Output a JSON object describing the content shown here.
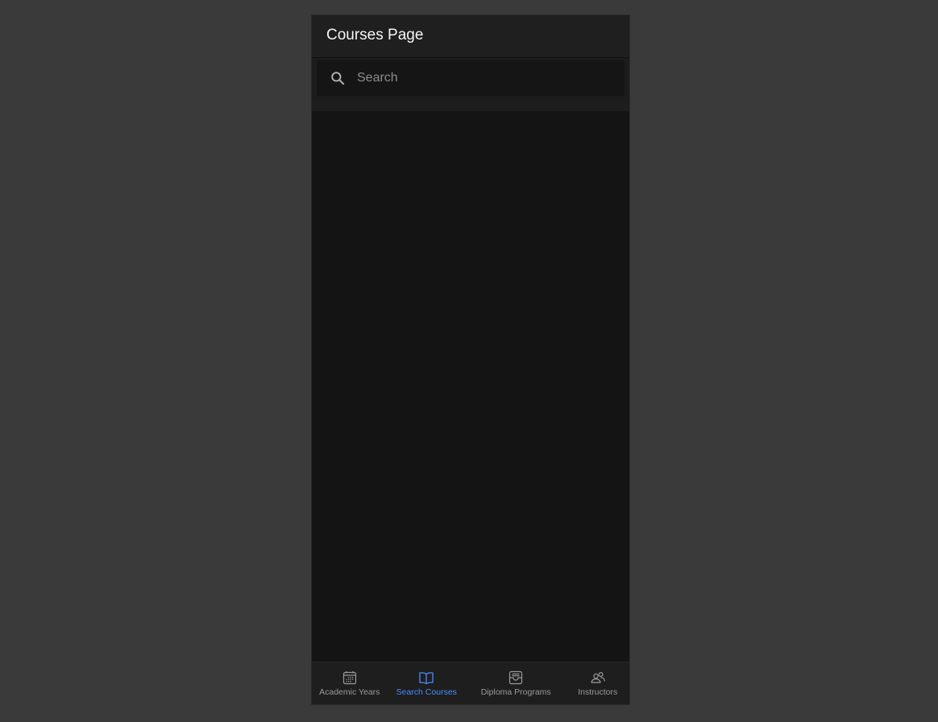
{
  "header": {
    "title": "Courses Page"
  },
  "search": {
    "placeholder": "Search",
    "value": ""
  },
  "tabs": [
    {
      "label": "Academic Years",
      "icon": "calendar-icon",
      "active": false
    },
    {
      "label": "Search Courses",
      "icon": "book-icon",
      "active": true
    },
    {
      "label": "Diploma Programs",
      "icon": "archive-icon",
      "active": false
    },
    {
      "label": "Instructors",
      "icon": "people-icon",
      "active": false
    }
  ],
  "colors": {
    "accent": "#4a8cff",
    "background": "#141414",
    "header": "#1f1f1f",
    "inactive_tab": "#9a9a9a"
  }
}
